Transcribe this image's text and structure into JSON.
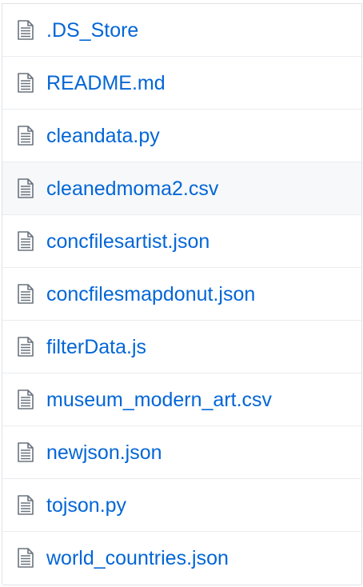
{
  "file_list": {
    "icon": "file-text-icon",
    "link_color": "#0366d6",
    "icon_color": "#6a737d",
    "highlight_color": "#f6f8fa",
    "items": [
      {
        "name": ".DS_Store"
      },
      {
        "name": "README.md"
      },
      {
        "name": "cleandata.py"
      },
      {
        "name": "cleanedmoma2.csv",
        "hovered": true
      },
      {
        "name": "concfilesartist.json"
      },
      {
        "name": "concfilesmapdonut.json"
      },
      {
        "name": "filterData.js"
      },
      {
        "name": "museum_modern_art.csv"
      },
      {
        "name": "newjson.json"
      },
      {
        "name": "tojson.py"
      },
      {
        "name": "world_countries.json"
      }
    ]
  }
}
